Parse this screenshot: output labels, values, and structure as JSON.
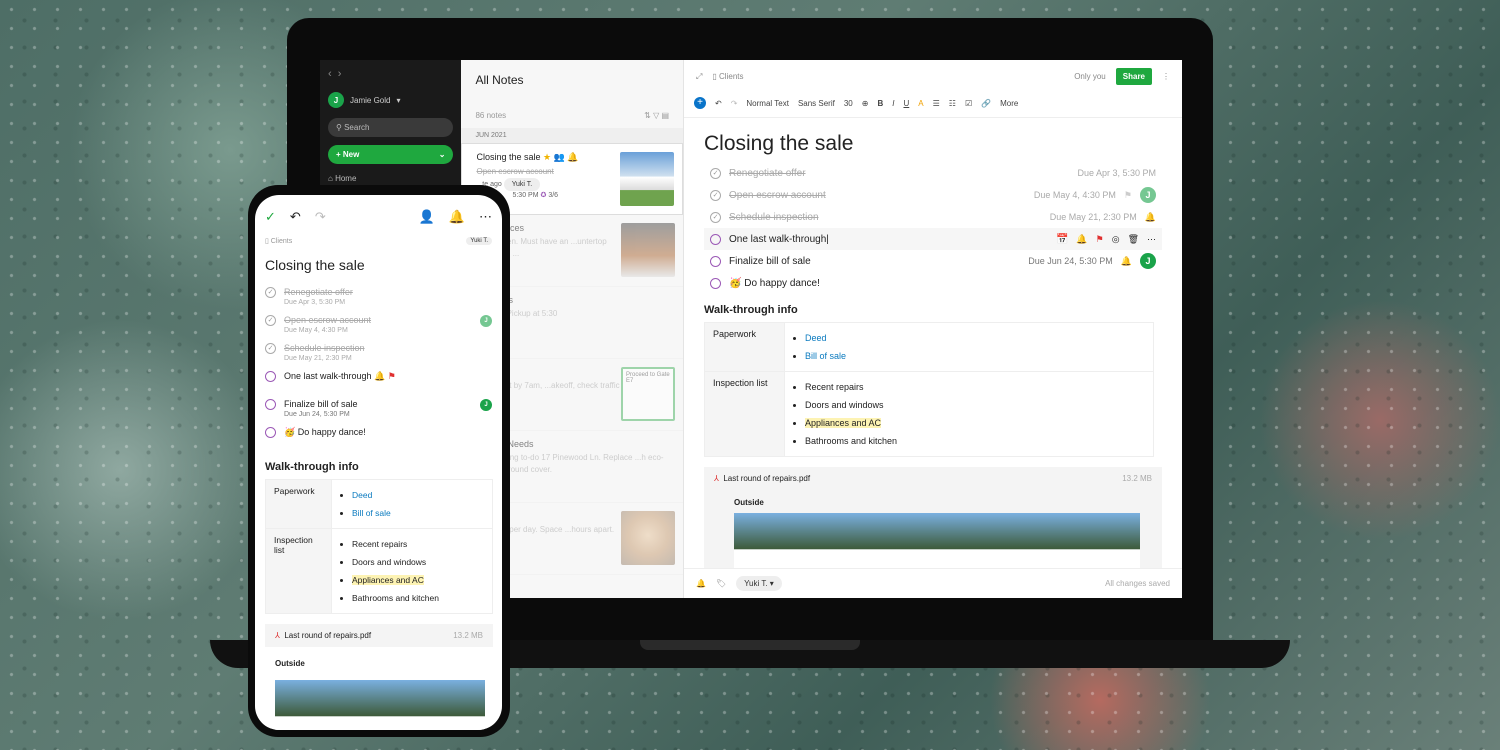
{
  "laptop": {
    "sidebar": {
      "user": "Jamie Gold",
      "user_initial": "J",
      "search": "Search",
      "new": "New",
      "home": "Home"
    },
    "list": {
      "title": "All Notes",
      "count": "86 notes",
      "month": "JUN 2021",
      "notes": [
        {
          "title": "Closing the sale",
          "snippet": "Open escrow account",
          "meta": "...te ago",
          "tag": "Yuki T.",
          "reminder": "5:30 PM",
          "tasks": "3/6"
        },
        {
          "title": "Preferences",
          "snippet": "...al kitchen. Must have an ...untertop that's well ..."
        },
        {
          "title": "...ograms",
          "snippet": "...ance - Pickup at 5:30"
        },
        {
          "title": "...etails",
          "snippet": "...e airport by 7am, ...akeoff, check traffic near ...",
          "thumb_text": "Proceed to Gate E7"
        },
        {
          "title": "...aping Needs",
          "snippet": "...ndscaping to-do 17 Pinewood Ln. Replace ...h eco-friendly ground cover."
        },
        {
          "title": "...ting",
          "snippet": "...d twice per day. Space ...hours apart. Please ..."
        }
      ]
    },
    "editor": {
      "notebook": "Clients",
      "visibility": "Only you",
      "share": "Share",
      "toolbar": {
        "style": "Normal Text",
        "font": "Sans Serif",
        "size": "30",
        "more": "More"
      },
      "title": "Closing the sale",
      "tasks": [
        {
          "text": "Renegotiate offer",
          "due": "Due Apr 3, 5:30 PM",
          "done": true
        },
        {
          "text": "Open escrow account",
          "due": "Due May 4, 4:30 PM",
          "done": true
        },
        {
          "text": "Schedule inspection",
          "due": "Due May 21, 2:30 PM",
          "done": true
        },
        {
          "text": "One last walk-through",
          "due": "",
          "done": false
        },
        {
          "text": "Finalize bill of sale",
          "due": "Due Jun 24, 5:30 PM",
          "done": false
        },
        {
          "text": "Do happy dance!",
          "emoji": "🥳",
          "due": "",
          "done": false
        }
      ],
      "section": "Walk-through info",
      "table": {
        "r1": "Paperwork",
        "r1_items": [
          "Deed",
          "Bill of sale"
        ],
        "r2": "Inspection list",
        "r2_items": [
          "Recent repairs",
          "Doors and windows",
          "Appliances and AC",
          "Bathrooms and kitchen"
        ]
      },
      "attachment": {
        "name": "Last round of repairs.pdf",
        "size": "13.2 MB",
        "caption": "Outside"
      },
      "footer": {
        "assignee": "Yuki T.",
        "status": "All changes saved"
      }
    }
  },
  "phone": {
    "notebook": "Clients",
    "tag": "Yuki T.",
    "title": "Closing the sale",
    "tasks": [
      {
        "text": "Renegotiate offer",
        "due": "Due Apr 3, 5:30 PM"
      },
      {
        "text": "Open escrow account",
        "due": "Due May 4, 4:30 PM"
      },
      {
        "text": "Schedule inspection",
        "due": "Due May 21, 2:30 PM"
      },
      {
        "text": "One last walk-through"
      },
      {
        "text": "Finalize bill of sale",
        "due": "Due Jun 24, 5:30 PM"
      },
      {
        "text": "Do happy dance!",
        "emoji": "🥳"
      }
    ],
    "section": "Walk-through info"
  },
  "colors": {
    "brand_green": "#1fa83f",
    "link": "#0a7abf",
    "highlight": "#fdf3b3",
    "task_circle": "#9b59b6"
  }
}
